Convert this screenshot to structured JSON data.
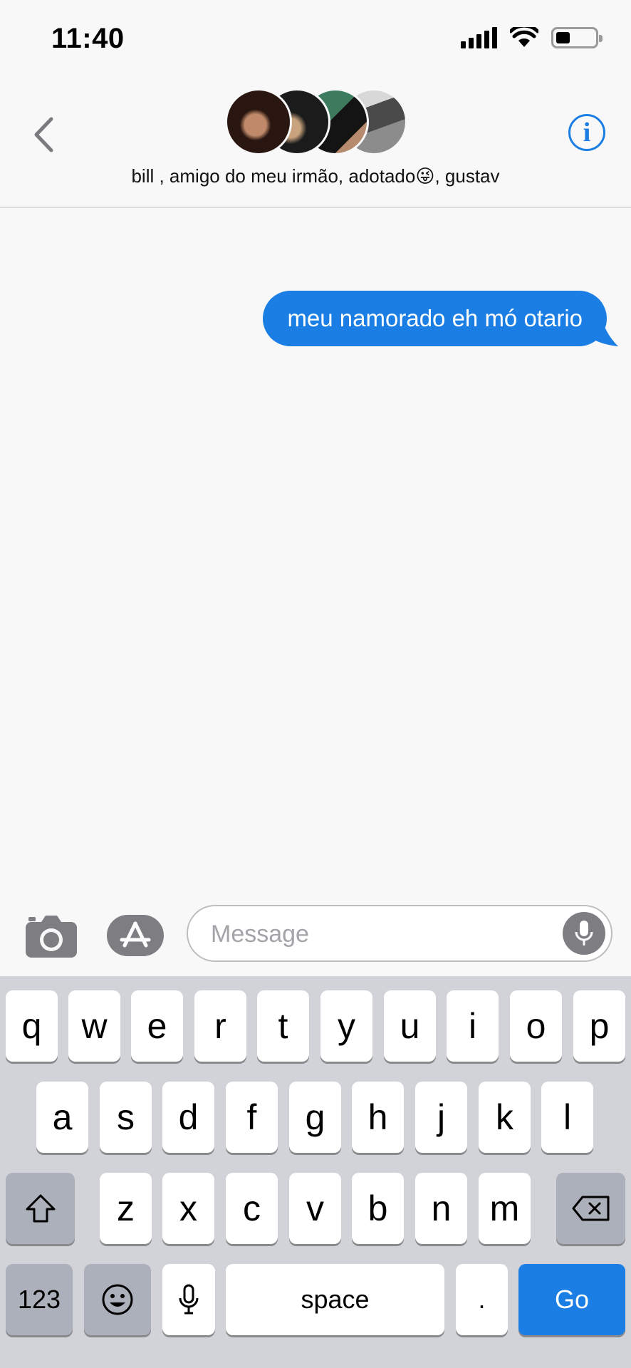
{
  "status_bar": {
    "time": "11:40",
    "icons": [
      "cellular-signal-icon",
      "wifi-icon",
      "battery-icon"
    ],
    "battery_level": 0.35
  },
  "header": {
    "title": "bill , amigo do meu irmão, adotado😜, gustav",
    "back_icon": "chevron-left-icon",
    "info_icon": "info-icon",
    "avatar_count": 4
  },
  "conversation": {
    "messages": [
      {
        "direction": "outgoing",
        "text": "meu namorado eh mó otario"
      }
    ]
  },
  "compose": {
    "placeholder": "Message",
    "camera_icon": "camera-icon",
    "apps_icon": "app-store-icon",
    "mic_icon": "microphone-icon"
  },
  "keyboard": {
    "row1": [
      "q",
      "w",
      "e",
      "r",
      "t",
      "y",
      "u",
      "i",
      "o",
      "p"
    ],
    "row2": [
      "a",
      "s",
      "d",
      "f",
      "g",
      "h",
      "j",
      "k",
      "l"
    ],
    "row3": [
      "z",
      "x",
      "c",
      "v",
      "b",
      "n",
      "m"
    ],
    "shift_icon": "shift-icon",
    "delete_icon": "backspace-icon",
    "numbers_label": "123",
    "emoji_icon": "emoji-icon",
    "dictation_icon": "microphone-icon",
    "space_label": "space",
    "period_label": ".",
    "go_label": "Go"
  },
  "colors": {
    "accent": "#1a7ee4",
    "background": "#f8f8f8",
    "keyboard_bg": "#d1d3d9"
  }
}
